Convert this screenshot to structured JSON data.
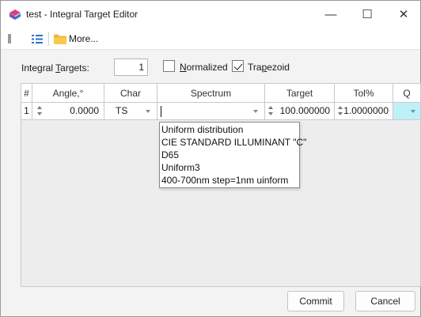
{
  "window": {
    "title": "test - Integral Target Editor",
    "controls": {
      "minimize": "—",
      "maximize": "☐",
      "close": "✕"
    },
    "icon": "app-logo-icon"
  },
  "toolbar": {
    "more_label": "More..."
  },
  "options": {
    "integral_targets_label_pre": "Integral ",
    "integral_targets_label_u": "T",
    "integral_targets_label_post": "argets:",
    "integral_targets_value": "1",
    "normalized_label_u": "N",
    "normalized_label_post": "ormalized",
    "normalized_checked": false,
    "trapezoid_label_pre": "Tra",
    "trapezoid_label_u": "p",
    "trapezoid_label_post": "ezoid",
    "trapezoid_checked": true
  },
  "grid": {
    "headers": [
      "#",
      "Angle,°",
      "Char",
      "Spectrum",
      "Target",
      "Tol%",
      "Q"
    ],
    "rows": [
      {
        "num": "1",
        "angle": "0.0000",
        "char": "TS",
        "spectrum": "",
        "target": "100.000000",
        "tol": "1.0000000",
        "q": ""
      }
    ]
  },
  "spectrum_dropdown": {
    "options": [
      "Uniform distribution",
      "CIE STANDARD ILLUMINANT \"C\"",
      "D65",
      "Uniform3",
      "400-700nm step=1nm uinform"
    ]
  },
  "footer": {
    "commit_label": "Commit",
    "cancel_label": "Cancel"
  },
  "colors": {
    "q_cell_highlight": "#bff0f7",
    "window_bg": "#f3f3f3"
  }
}
